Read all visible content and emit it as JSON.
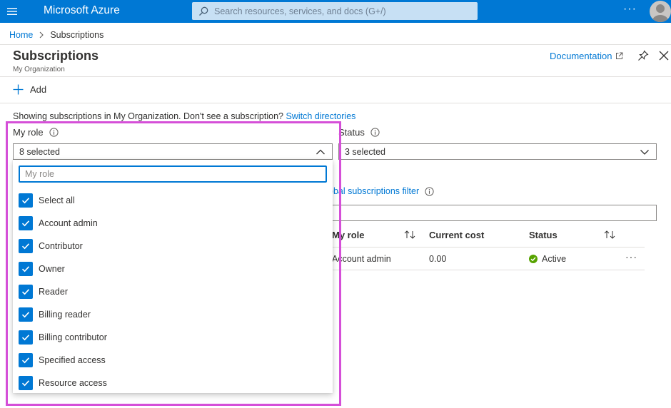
{
  "topbar": {
    "brand": "Microsoft Azure",
    "search_placeholder": "Search resources, services, and docs (G+/)",
    "more": "···"
  },
  "breadcrumb": {
    "home": "Home",
    "current": "Subscriptions"
  },
  "page": {
    "title": "Subscriptions",
    "subtitle": "My Organization",
    "documentation": "Documentation"
  },
  "commands": {
    "add": "Add"
  },
  "info": {
    "text": "Showing subscriptions in My Organization. Don't see a subscription?",
    "switch_link": "Switch directories"
  },
  "filters": {
    "my_role_label": "My role",
    "my_role_value": "8 selected",
    "status_label": "Status",
    "status_value": "3 selected",
    "global_filter_link": "obal subscriptions filter"
  },
  "dropdown": {
    "search_placeholder": "My role",
    "options": [
      {
        "label": "Select all",
        "checked": true
      },
      {
        "label": "Account admin",
        "checked": true
      },
      {
        "label": "Contributor",
        "checked": true
      },
      {
        "label": "Owner",
        "checked": true
      },
      {
        "label": "Reader",
        "checked": true
      },
      {
        "label": "Billing reader",
        "checked": true
      },
      {
        "label": "Billing contributor",
        "checked": true
      },
      {
        "label": "Specified access",
        "checked": true
      },
      {
        "label": "Resource access",
        "checked": true
      }
    ]
  },
  "table": {
    "headers": {
      "role": "My role",
      "cost": "Current cost",
      "status": "Status"
    },
    "rows": [
      {
        "role": "Account admin",
        "cost": "0.00",
        "status": "Active",
        "more": "···"
      }
    ]
  },
  "colors": {
    "accent": "#0078d4",
    "active_green": "#57a300",
    "highlight": "#d54fd8"
  }
}
